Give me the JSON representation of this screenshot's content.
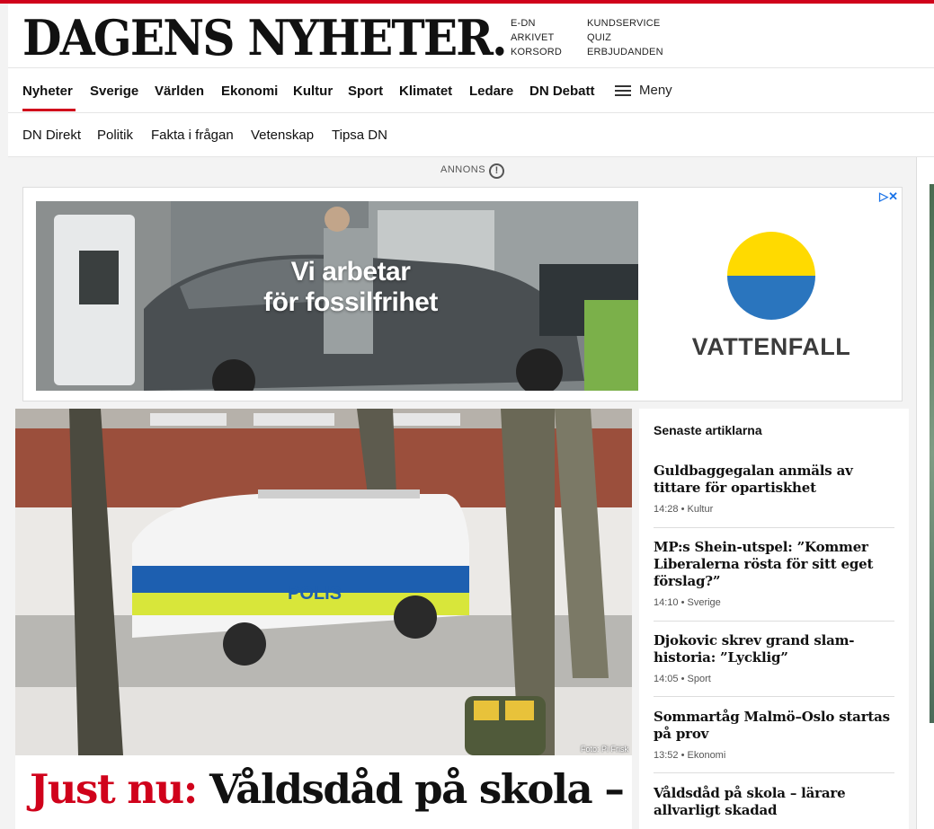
{
  "header": {
    "logo": "DAGENS NYHETER.",
    "quick_links_col1": [
      "E-DN",
      "ARKIVET",
      "KORSORD"
    ],
    "quick_links_col2": [
      "KUNDSERVICE",
      "QUIZ",
      "ERBJUDANDEN"
    ]
  },
  "nav": {
    "items": [
      "Nyheter",
      "Sverige",
      "Världen",
      "Ekonomi",
      "Kultur",
      "Sport",
      "Klimatet",
      "Ledare",
      "DN Debatt"
    ],
    "active": "Nyheter",
    "menu_label": "Meny"
  },
  "subnav": {
    "items": [
      "DN Direkt",
      "Politik",
      "Fakta i frågan",
      "Vetenskap",
      "Tipsa DN"
    ]
  },
  "ad": {
    "label": "ANNONS",
    "info_glyph": "!",
    "controls": "▷✕",
    "headline_line1": "Vi arbetar",
    "headline_line2": "för fossilfrihet",
    "brand": "VATTENFALL",
    "brand_colors": {
      "yellow": "#ffda00",
      "blue": "#2a75be"
    }
  },
  "main_article": {
    "photo_credit": "Foto: Pi Frisk",
    "kicker": "Just nu:",
    "headline": "Våldsdåd på skola –",
    "vehicle_text": "POLIS"
  },
  "latest": {
    "title": "Senaste artiklarna",
    "items": [
      {
        "title": "Guldbaggegalan anmäls av tittare för opartiskhet",
        "meta": "14:28 • Kultur"
      },
      {
        "title": "MP:s Shein-utspel: ”Kommer Liberalerna rösta för sitt eget förslag?”",
        "meta": "14:10 • Sverige"
      },
      {
        "title": "Djokovic skrev grand slam-historia: ”Lycklig”",
        "meta": "14:05 • Sport"
      },
      {
        "title": "Sommartåg Malmö–Oslo startas på prov",
        "meta": "13:52 • Ekonomi"
      },
      {
        "title": "Våldsdåd på skola – lärare allvarligt skadad",
        "meta": ""
      }
    ]
  },
  "colors": {
    "accent": "#d0021b"
  }
}
